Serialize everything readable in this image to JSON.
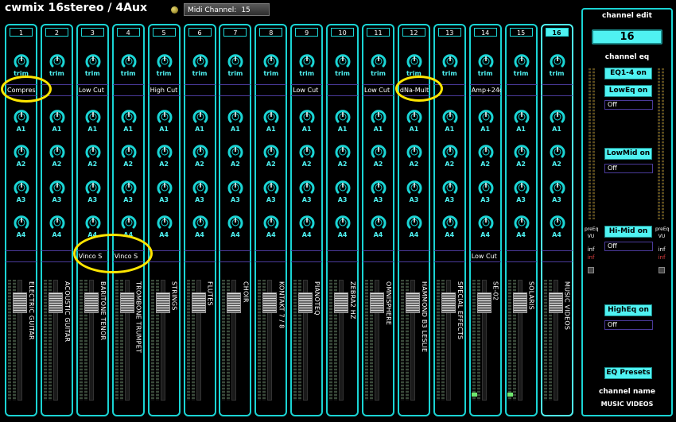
{
  "app_title": "cwmix 16stereo / 4Aux",
  "midi": {
    "label": "Midi Channel:",
    "value": "15"
  },
  "knob_labels": {
    "trim": "trim",
    "a1": "A1",
    "a2": "A2",
    "a3": "A3",
    "a4": "A4"
  },
  "channels": [
    {
      "num": "1",
      "fx": "Compres",
      "insert": "",
      "name": "ELECTRIC GUITAR"
    },
    {
      "num": "2",
      "fx": "",
      "insert": "",
      "name": "ACOUSTIC GUITAR"
    },
    {
      "num": "3",
      "fx": "Low Cut",
      "insert": "Vinco S",
      "name": "BARITONE TENOR"
    },
    {
      "num": "4",
      "fx": "",
      "insert": "Vinco S",
      "name": "TROMBONE TRUMPET"
    },
    {
      "num": "5",
      "fx": "High Cut",
      "insert": "",
      "name": "STRINGS"
    },
    {
      "num": "6",
      "fx": "",
      "insert": "",
      "name": "FLUTES"
    },
    {
      "num": "7",
      "fx": "",
      "insert": "",
      "name": "CHOIR"
    },
    {
      "num": "8",
      "fx": "",
      "insert": "",
      "name": "KONTAKT 7 / 8"
    },
    {
      "num": "9",
      "fx": "Low Cut",
      "insert": "",
      "name": "PIANOTEQ"
    },
    {
      "num": "10",
      "fx": "",
      "insert": "",
      "name": "ZEBRA2 HZ"
    },
    {
      "num": "11",
      "fx": "Low Cut",
      "insert": "",
      "name": "OMNISPHERE"
    },
    {
      "num": "12",
      "fx": "dNa-Mult",
      "insert": "",
      "name": "HAMMOND B3 LESLIE"
    },
    {
      "num": "13",
      "fx": "",
      "insert": "",
      "name": "SPECIAL EFFECTS"
    },
    {
      "num": "14",
      "fx": "Amp+24c",
      "insert": "Low Cut",
      "name": "SE-02"
    },
    {
      "num": "15",
      "fx": "",
      "insert": "",
      "name": "SOLARIS"
    },
    {
      "num": "16",
      "fx": "",
      "insert": "",
      "name": "MUSIC VIDEOS"
    }
  ],
  "selected_channel": "16",
  "channel_edit": {
    "title": "channel edit",
    "number": "16",
    "eq_title": "channel eq",
    "eq14_button": "EQ1-4 on",
    "loweq_button": "LowEq on",
    "loweq_value": "Off",
    "lowmid_button": "LowMid on",
    "lowmid_value": "Off",
    "himid_button": "Hi-Mid on",
    "himid_value": "Off",
    "higheq_button": "HighEq on",
    "higheq_value": "Off",
    "preset_button": "EQ Presets",
    "name_title": "channel name",
    "name_value": "MUSIC VIDEOS",
    "pre_label": "preEq",
    "vu_label": "VU",
    "inf_white": "inf",
    "inf_red": "inf"
  },
  "colors": {
    "accent": "#1ad4d4",
    "button": "#4ff2f2",
    "highlight": "#ffe600",
    "meter_green": "#6ee86e"
  }
}
